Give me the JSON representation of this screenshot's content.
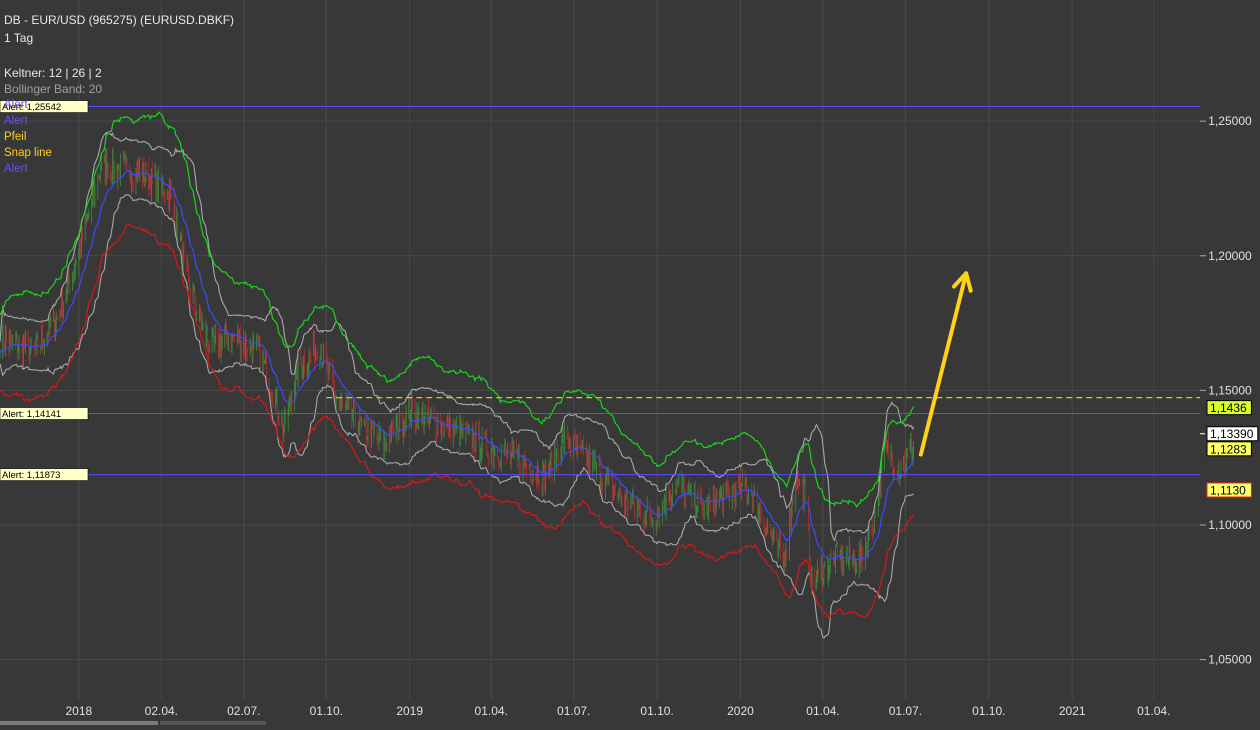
{
  "header": {
    "title": "DB - EUR/USD (965275) (EURUSD.DBKF)",
    "interval": "1 Tag",
    "indicator": "Keltner: 12 | 26 | 2",
    "indicator2": "Bollinger Band: 20"
  },
  "legend": [
    {
      "label": "Alert",
      "color": "#6a4cff"
    },
    {
      "label": "Alert",
      "color": "#6a4cff"
    },
    {
      "label": "Pfeil",
      "color": "#ffd21a"
    },
    {
      "label": "Snap line",
      "color": "#ffd21a"
    },
    {
      "label": "Alert",
      "color": "#6a4cff"
    }
  ],
  "colors": {
    "background": "#383838",
    "grid": "#4a4a4a",
    "alert_line": "#5a4cff",
    "snap_line": "#f0c010",
    "arrow": "#ffd21a",
    "keltner_upper": "#19d419",
    "keltner_mid": "#3a4cff",
    "keltner_lower": "#d41919",
    "bollinger": "#a8a8a8",
    "candle_up": "#3e9e3e",
    "candle_down": "#c03030"
  },
  "chart_data": {
    "type": "candlestick",
    "y_ticks": [
      "1,25000",
      "1,20000",
      "1,15000",
      "1,10000",
      "1,05000"
    ],
    "y_tick_values": [
      1.25,
      1.2,
      1.15,
      1.1,
      1.05
    ],
    "ylim": [
      1.035,
      1.295
    ],
    "x_ticks": [
      "2018",
      "02.04.",
      "02.07.",
      "01.10.",
      "2019",
      "01.04.",
      "01.07.",
      "01.10.",
      "2020",
      "01.04.",
      "01.07.",
      "01.10.",
      "2021",
      "01.04."
    ],
    "x_tick_dates": [
      "2018-01-01",
      "2018-04-02",
      "2018-07-02",
      "2018-10-01",
      "2019-01-01",
      "2019-04-01",
      "2019-07-01",
      "2019-10-01",
      "2020-01-01",
      "2020-04-01",
      "2020-07-01",
      "2020-10-01",
      "2021-01-01",
      "2021-04-01"
    ],
    "xlim": [
      "2017-10-06",
      "2021-05-22"
    ],
    "price_series_dates": [
      "2017-10-06",
      "2017-11-13",
      "2017-12-08",
      "2018-01-02",
      "2018-01-26",
      "2018-02-16",
      "2018-03-12",
      "2018-04-13",
      "2018-05-01",
      "2018-05-25",
      "2018-06-22",
      "2018-07-20",
      "2018-08-15",
      "2018-08-31",
      "2018-09-24",
      "2018-10-10",
      "2018-11-05",
      "2018-12-03",
      "2019-01-01",
      "2019-01-28",
      "2019-02-25",
      "2019-03-22",
      "2019-04-23",
      "2019-05-30",
      "2019-06-21",
      "2019-07-19",
      "2019-08-26",
      "2019-09-27",
      "2019-10-21",
      "2019-11-20",
      "2019-12-16",
      "2020-01-10",
      "2020-02-17",
      "2020-03-02",
      "2020-03-12",
      "2020-03-20",
      "2020-04-13",
      "2020-05-13",
      "2020-05-29",
      "2020-06-08",
      "2020-06-25",
      "2020-07-10"
    ],
    "price_series_values": [
      1.169,
      1.164,
      1.177,
      1.202,
      1.234,
      1.232,
      1.231,
      1.222,
      1.19,
      1.166,
      1.17,
      1.164,
      1.136,
      1.158,
      1.167,
      1.148,
      1.137,
      1.13,
      1.142,
      1.138,
      1.134,
      1.13,
      1.125,
      1.118,
      1.132,
      1.123,
      1.109,
      1.102,
      1.115,
      1.106,
      1.111,
      1.114,
      1.086,
      1.118,
      1.112,
      1.078,
      1.088,
      1.087,
      1.104,
      1.129,
      1.121,
      1.13
    ],
    "series": [
      {
        "name": "Keltner upper"
      },
      {
        "name": "Keltner mid"
      },
      {
        "name": "Keltner lower"
      },
      {
        "name": "Bollinger upper"
      },
      {
        "name": "Bollinger lower"
      }
    ],
    "horizontal_lines": [
      {
        "label": "Alert: 1,25542",
        "value": 1.25542,
        "style": "solid",
        "kind": "alert"
      },
      {
        "label": "Alert: 1,14141",
        "value": 1.14141,
        "style": "solid",
        "kind": "alert"
      },
      {
        "label": "Alert: 1,11873",
        "value": 1.11873,
        "style": "solid",
        "kind": "alert"
      },
      {
        "value": 1.1473,
        "style": "dashed",
        "kind": "snap",
        "start_date": "2018-10-01"
      }
    ],
    "arrow": {
      "from_date": "2020-07-18",
      "from_value": 1.1262,
      "to_date": "2020-09-06",
      "to_value": 1.1935
    },
    "price_tags": [
      {
        "label": "1,1436",
        "value": 1.1436,
        "bg": "#d8ff2a",
        "fg": "#000000",
        "border": "#000000"
      },
      {
        "label": "1,13390",
        "value": 1.1339,
        "bg": "#ffffff",
        "fg": "#000000",
        "border": "#000000",
        "marker": true
      },
      {
        "label": "1,1283",
        "value": 1.1283,
        "bg": "#ffff66",
        "fg": "#000000",
        "border": "#000000"
      },
      {
        "label": "1,1130",
        "value": 1.113,
        "bg": "#ffff66",
        "fg": "#000000",
        "border": "#ff2020"
      }
    ],
    "grid": true
  }
}
